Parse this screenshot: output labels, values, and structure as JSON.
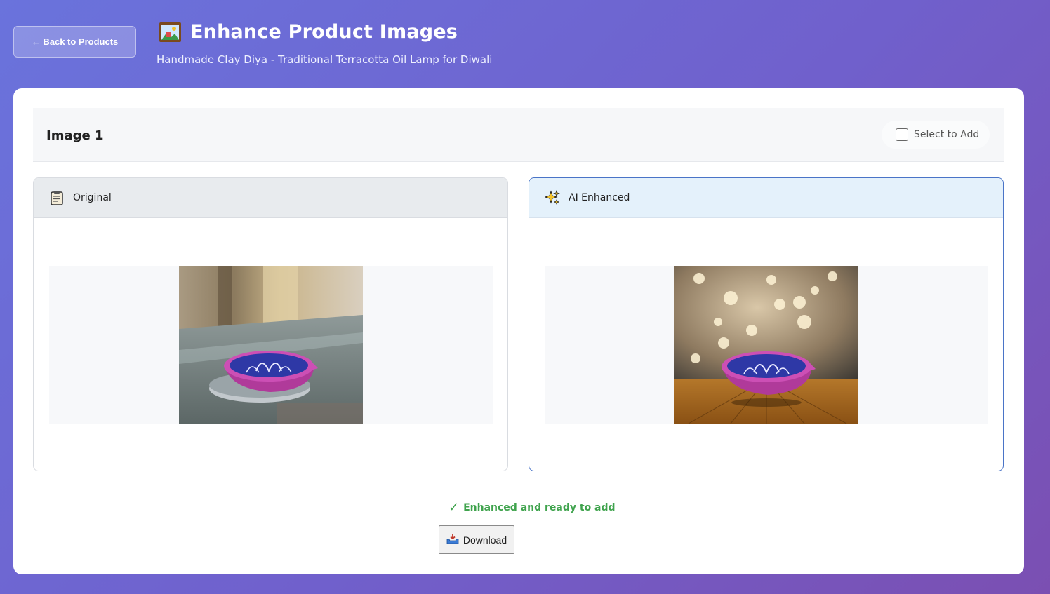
{
  "header": {
    "back_label": "← Back to Products",
    "title": "Enhance Product Images",
    "title_icon": "framed-picture-icon",
    "subtitle": "Handmade Clay Diya - Traditional Terracotta Oil Lamp for Diwali"
  },
  "card": {
    "image_label": "Image 1",
    "select_label": "Select to Add",
    "select_checked": false
  },
  "panels": {
    "original": {
      "label": "Original",
      "icon": "clipboard-icon"
    },
    "enhanced": {
      "label": "AI Enhanced",
      "icon": "sparkles-icon"
    }
  },
  "status": {
    "text": "Enhanced and ready to add",
    "check": "✓",
    "color": "#3fa34d"
  },
  "download": {
    "label": "Download",
    "icon": "inbox-tray-icon"
  },
  "colors": {
    "accent_border": "#4a74c7",
    "enhanced_header_bg": "#e4f1fb"
  }
}
